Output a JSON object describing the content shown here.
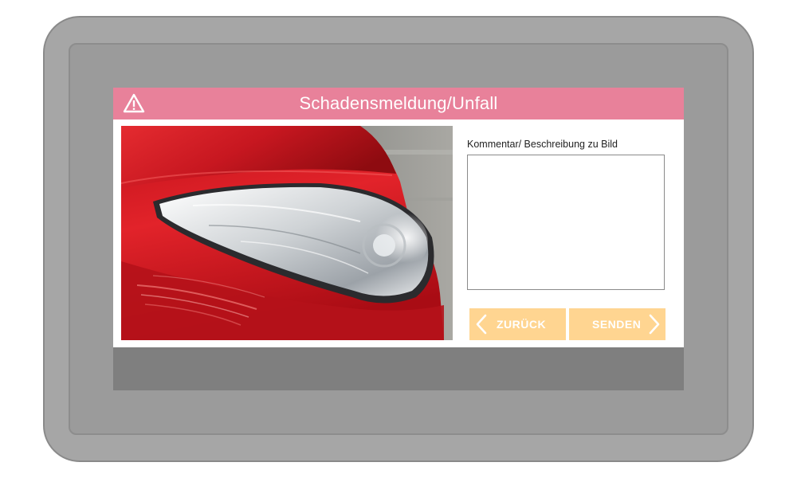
{
  "app": {
    "title": "Schadensmeldung/Unfall",
    "title_icon": "warning-triangle-icon"
  },
  "photo": {
    "subject": "red car headlight",
    "icon": "photo"
  },
  "comment": {
    "label": "Kommentar/ Beschreibung zu Bild",
    "value": "",
    "placeholder": ""
  },
  "buttons": {
    "back_label": "ZURÜCK",
    "back_icon": "chevron-left-icon",
    "send_label": "SENDEN",
    "send_icon": "chevron-right-icon"
  },
  "colors": {
    "titlebar": "#e8819a",
    "button": "#ffd591",
    "device_frame": "#a6a6a6",
    "screen_bezel": "#7f7f7f"
  }
}
